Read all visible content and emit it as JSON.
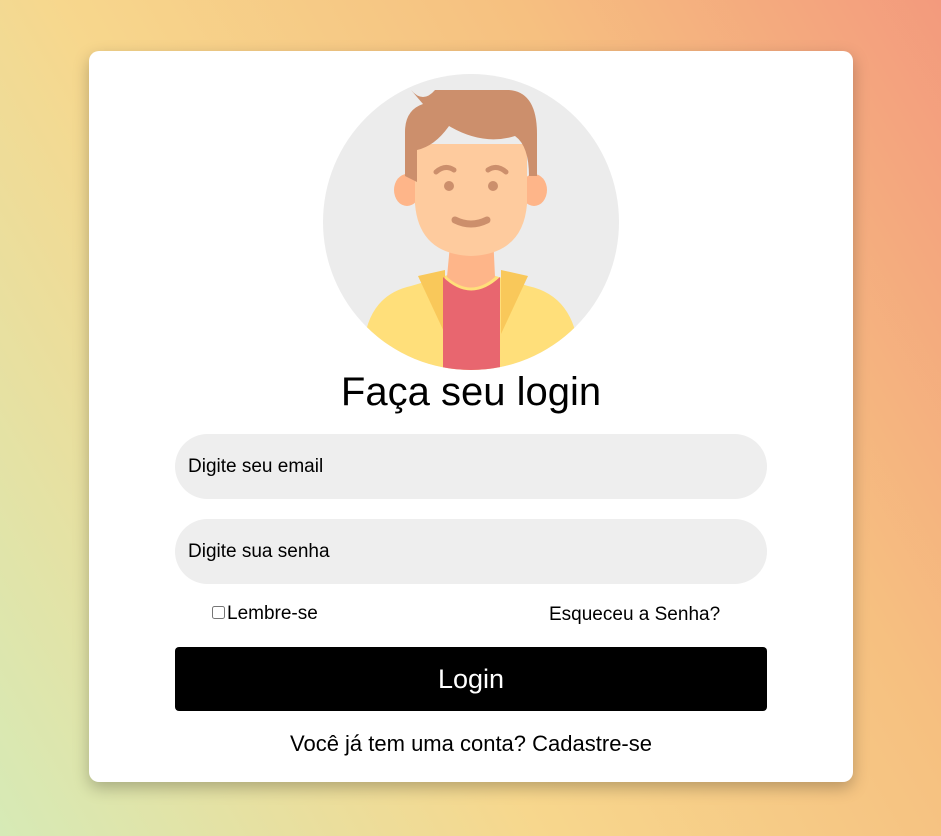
{
  "login": {
    "title": "Faça seu login",
    "email_placeholder": "Digite seu email",
    "password_placeholder": "Digite sua senha",
    "remember_label": "Lembre-se",
    "forgot_label": "Esqueceu a Senha?",
    "login_button_label": "Login",
    "signup_prompt": "Você já tem uma conta?",
    "signup_link_label": "Cadastre-se"
  },
  "avatar": {
    "icon": "user-avatar-icon"
  },
  "colors": {
    "card": "#ffffff",
    "button": "#000000",
    "input": "#eeeeee",
    "avatar_bg": "#ececec"
  }
}
